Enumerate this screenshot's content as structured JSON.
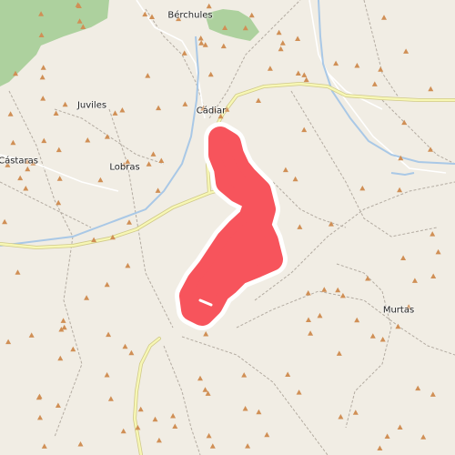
{
  "map": {
    "places": [
      {
        "name": "Bérchules"
      },
      {
        "name": "Juviles"
      },
      {
        "name": "Cádiar"
      },
      {
        "name": "Cástaras"
      },
      {
        "name": "Lobras"
      },
      {
        "name": "Murtas"
      }
    ],
    "colors": {
      "background": "#f1ede4",
      "forest": "#add19e",
      "road_major": "#f7f7b4",
      "road_casing": "#d0c98a",
      "river": "#a9c8e6",
      "track": "#b3aba1",
      "peak": "#d08f55",
      "route": "#f7545c",
      "route_halo": "#ffffff"
    },
    "icons": [
      "peak-icon"
    ]
  }
}
